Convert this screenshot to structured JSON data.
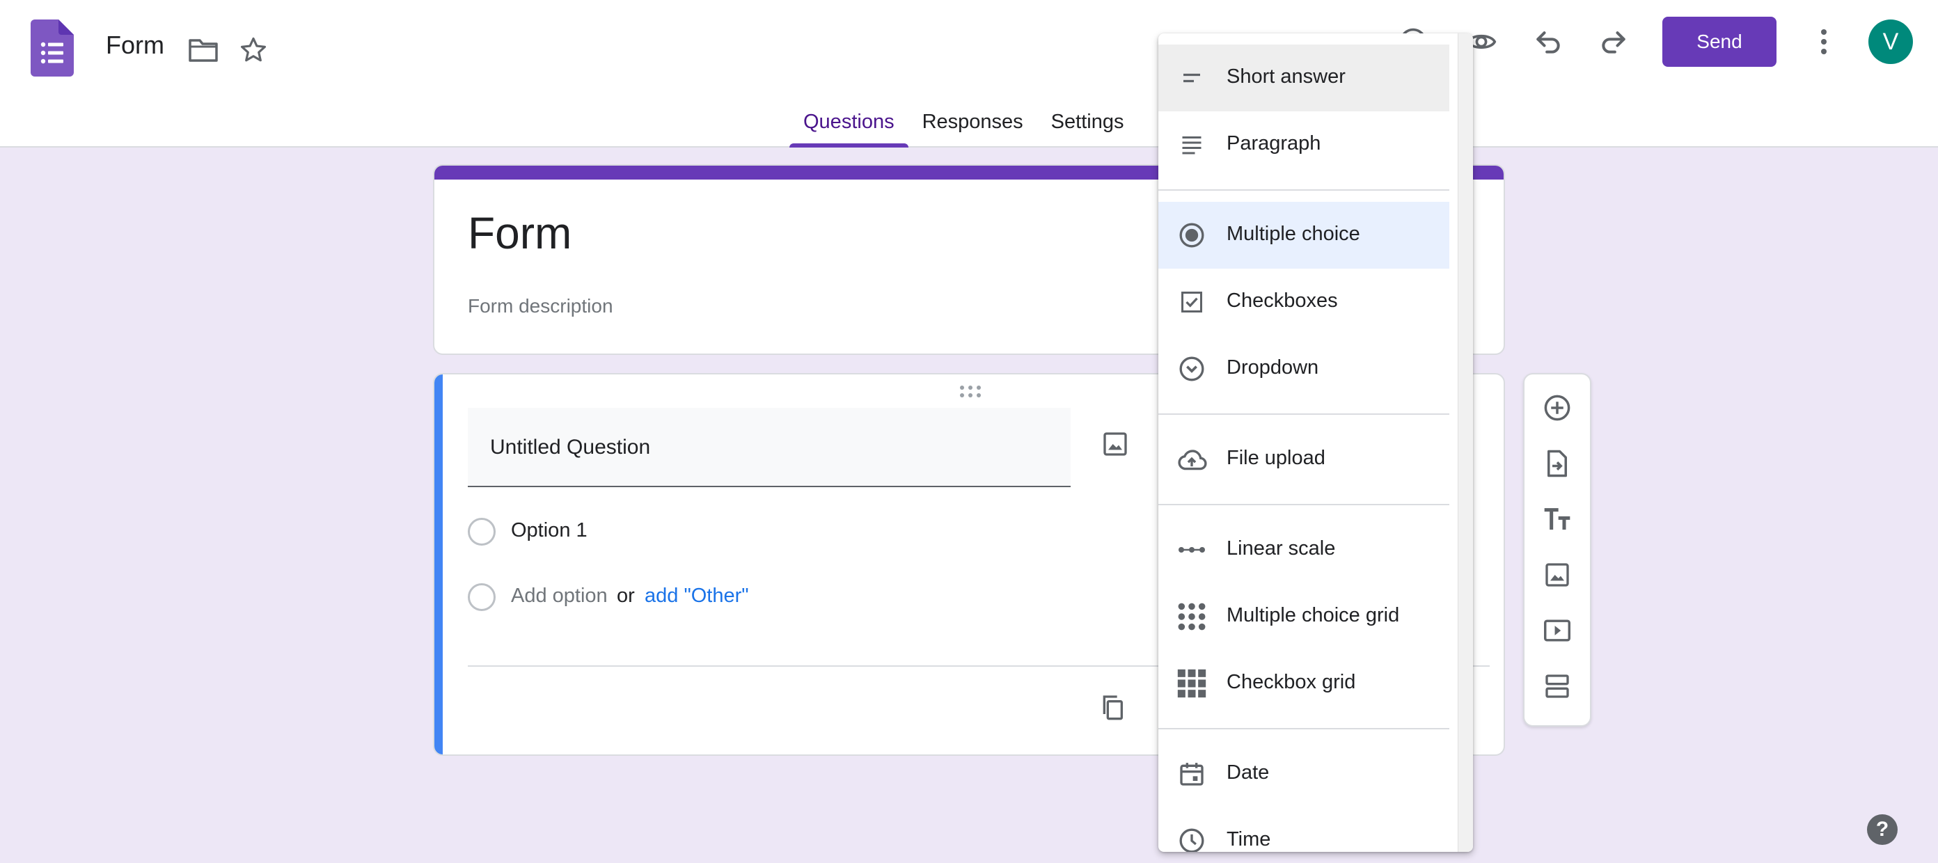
{
  "header": {
    "doc_title": "Form",
    "send_label": "Send",
    "avatar_initial": "V",
    "tabs": [
      {
        "label": "Questions"
      },
      {
        "label": "Responses"
      },
      {
        "label": "Settings"
      }
    ]
  },
  "form": {
    "title": "Form",
    "description_placeholder": "Form description"
  },
  "question": {
    "title": "Untitled Question",
    "option1": "Option 1",
    "add_option": "Add option",
    "or": "or",
    "add_other": "add \"Other\""
  },
  "menu": {
    "items": [
      {
        "label": "Short answer",
        "icon": "short-answer-icon"
      },
      {
        "label": "Paragraph",
        "icon": "paragraph-icon"
      },
      {
        "label": "Multiple choice",
        "icon": "radio-button-icon"
      },
      {
        "label": "Checkboxes",
        "icon": "checkbox-icon"
      },
      {
        "label": "Dropdown",
        "icon": "dropdown-icon"
      },
      {
        "label": "File upload",
        "icon": "cloud-upload-icon"
      },
      {
        "label": "Linear scale",
        "icon": "linear-scale-icon"
      },
      {
        "label": "Multiple choice grid",
        "icon": "dot-grid-icon"
      },
      {
        "label": "Checkbox grid",
        "icon": "square-grid-icon"
      },
      {
        "label": "Date",
        "icon": "calendar-icon"
      },
      {
        "label": "Time",
        "icon": "clock-icon"
      }
    ],
    "hovered": "Short answer",
    "selected": "Multiple choice"
  },
  "help": {
    "label": "?"
  },
  "colors": {
    "accent": "#673ab7",
    "background": "#ede7f6",
    "question_bar": "#4285f4",
    "link": "#1a73e8"
  }
}
